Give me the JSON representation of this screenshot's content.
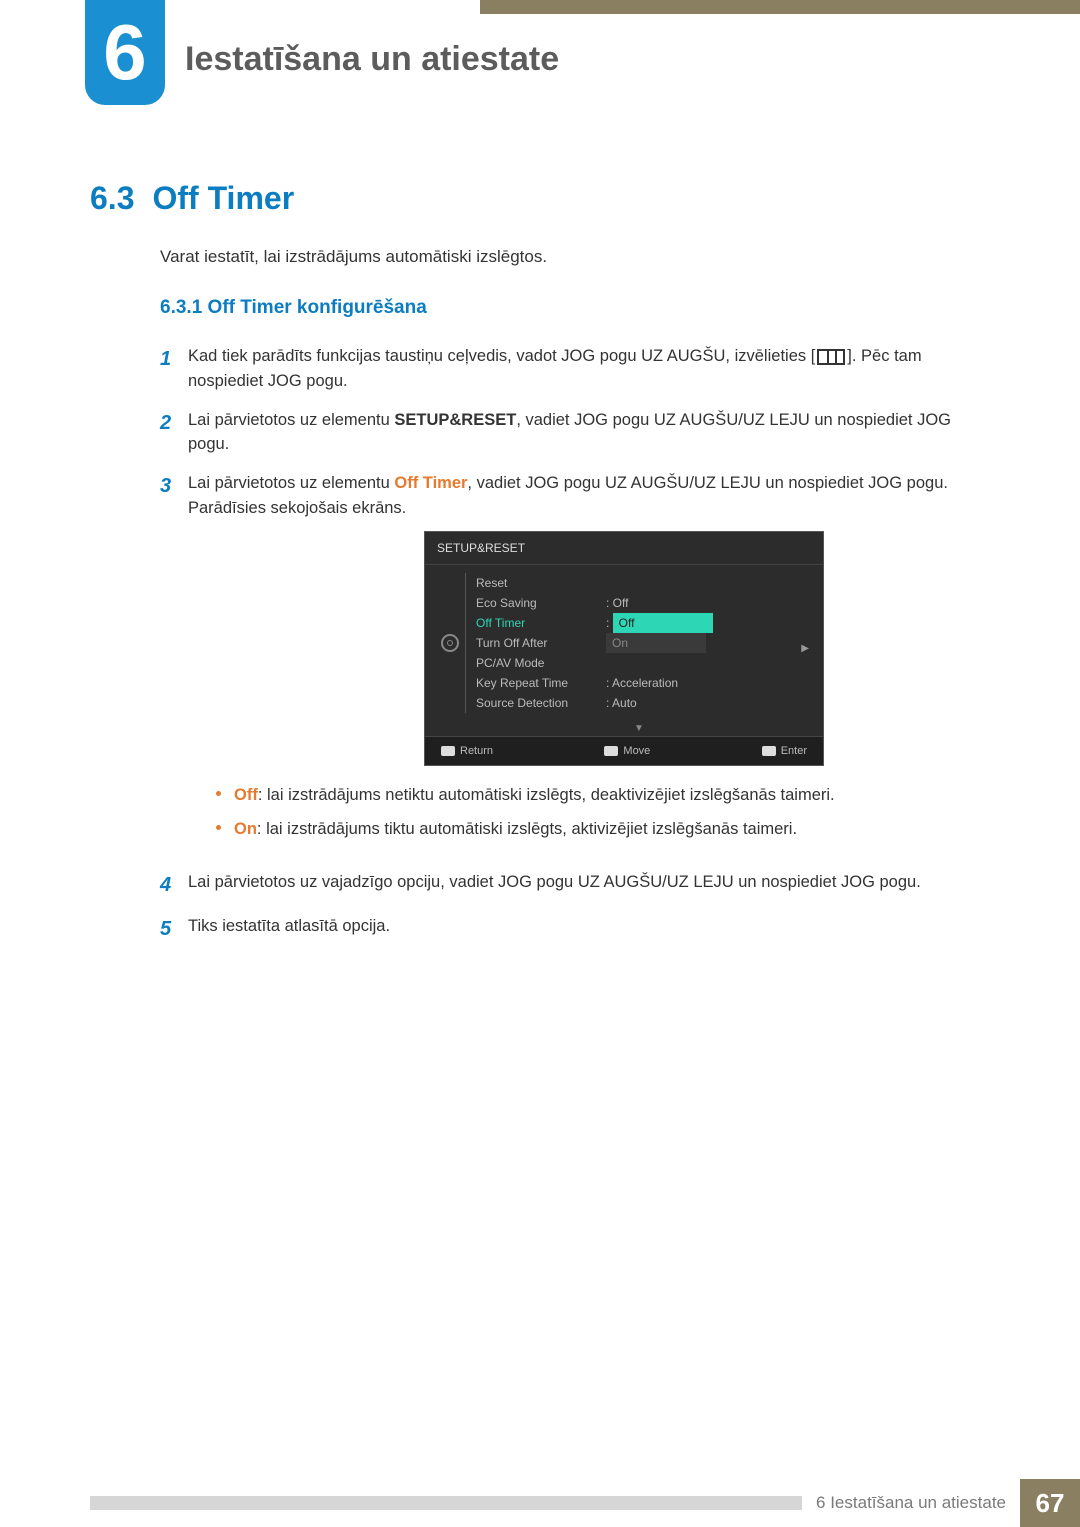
{
  "chapter": {
    "number": "6",
    "title": "Iestatīšana un atiestate"
  },
  "section": {
    "number": "6.3",
    "title": "Off Timer"
  },
  "intro": "Varat iestatīt, lai izstrādājums automātiski izslēgtos.",
  "subsection": {
    "number": "6.3.1",
    "title": "Off Timer konfigurēšana"
  },
  "steps": {
    "s1": {
      "num": "1",
      "part_a": "Kad tiek parādīts funkcijas taustiņu ceļvedis, vadot JOG pogu UZ AUGŠU, izvēlieties [",
      "part_b": "]. Pēc tam nospiediet JOG pogu."
    },
    "s2": {
      "num": "2",
      "pre": "Lai pārvietotos uz elementu ",
      "emph": "SETUP&RESET",
      "post": ", vadiet JOG pogu UZ AUGŠU/UZ LEJU un nospiediet JOG pogu."
    },
    "s3": {
      "num": "3",
      "pre": "Lai pārvietotos uz elementu ",
      "emph": "Off Timer",
      "post": ", vadiet JOG pogu UZ AUGŠU/UZ LEJU un nospiediet JOG pogu. Parādīsies sekojošais ekrāns."
    },
    "s4": {
      "num": "4",
      "text": "Lai pārvietotos uz vajadzīgo opciju, vadiet JOG pogu UZ AUGŠU/UZ LEJU un nospiediet JOG pogu."
    },
    "s5": {
      "num": "5",
      "text": "Tiks iestatīta atlasītā opcija."
    }
  },
  "bullets": {
    "off": {
      "key": "Off",
      "text": ": lai izstrādājums netiktu automātiski izslēgts, deaktivizējiet izslēgšanās taimeri."
    },
    "on": {
      "key": "On",
      "text": ": lai izstrādājums tiktu automātiski izslēgts, aktivizējiet izslēgšanās taimeri."
    }
  },
  "osd": {
    "title": "SETUP&RESET",
    "items": {
      "reset": {
        "label": "Reset",
        "val": ""
      },
      "eco": {
        "label": "Eco Saving",
        "val": "Off"
      },
      "offtimer": {
        "label": "Off Timer",
        "sel": "Off",
        "alt": "On"
      },
      "turnoff": {
        "label": "Turn Off After",
        "val": ""
      },
      "pcav": {
        "label": "PC/AV Mode",
        "val": ""
      },
      "keyr": {
        "label": "Key Repeat Time",
        "val": "Acceleration"
      },
      "srcdet": {
        "label": "Source Detection",
        "val": "Auto"
      }
    },
    "footer": {
      "return": "Return",
      "move": "Move",
      "enter": "Enter"
    }
  },
  "footer": {
    "label": "6 Iestatīšana un atiestate",
    "page": "67"
  }
}
